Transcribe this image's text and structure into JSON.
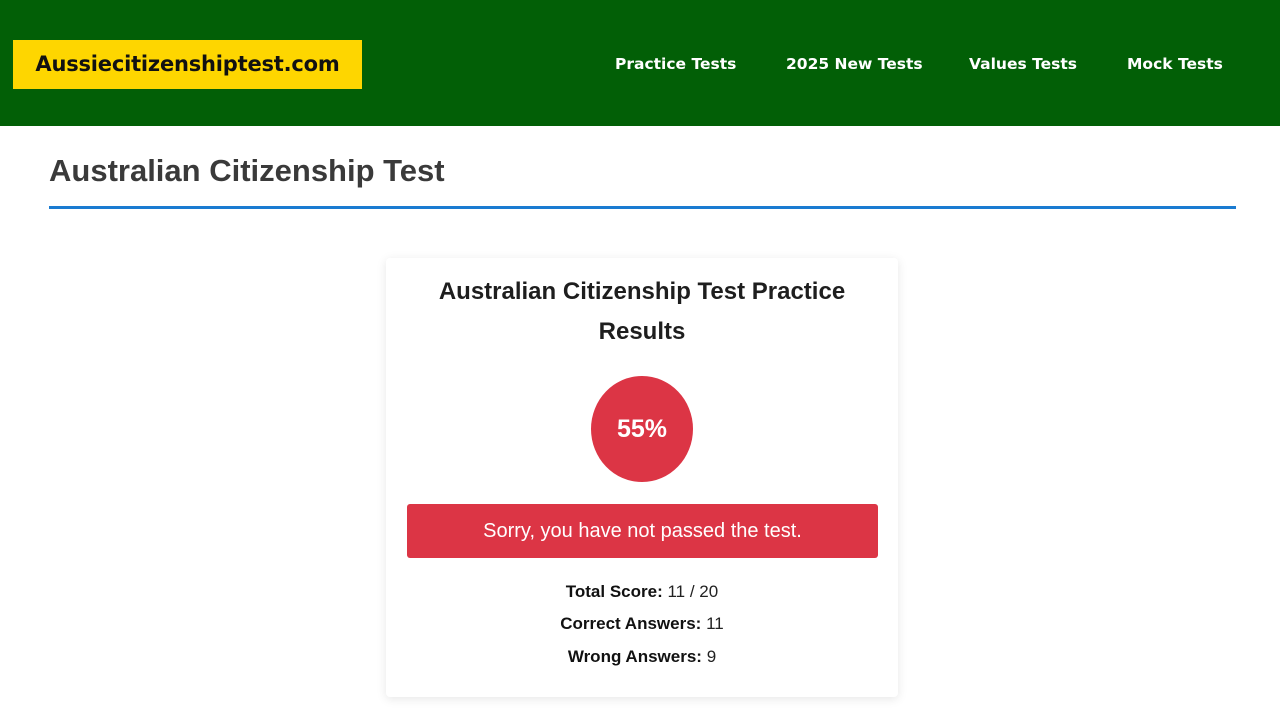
{
  "header": {
    "logo_text": "Aussiecitizenshiptest.com",
    "background_color": "#025f06",
    "logo_background_color": "#fed600",
    "nav": [
      {
        "label": "Practice Tests"
      },
      {
        "label": "2025 New Tests"
      },
      {
        "label": "Values Tests"
      },
      {
        "label": "Mock Tests"
      }
    ]
  },
  "page": {
    "title": "Australian Citizenship Test",
    "rule_color": "#1a7bd1"
  },
  "results": {
    "title": "Australian Citizenship Test Practice Results",
    "score_percent": "55%",
    "status_message": "Sorry, you have not passed the test.",
    "status_color": "#dc3545",
    "total_score_label": "Total Score:",
    "total_score_value": "11 / 20",
    "correct_label": "Correct Answers:",
    "correct_value": "11",
    "wrong_label": "Wrong Answers:",
    "wrong_value": "9"
  }
}
